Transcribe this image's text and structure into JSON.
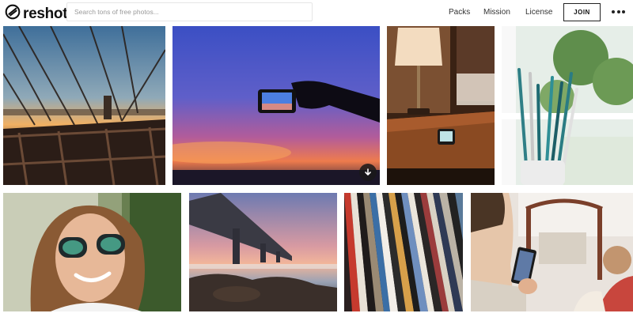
{
  "header": {
    "brand": "reshot",
    "search_placeholder": "Search tons of free photos...",
    "nav": {
      "packs": "Packs",
      "mission": "Mission",
      "license": "License"
    },
    "join_label": "JOIN"
  },
  "icons": {
    "logo": "reshot-logo-icon",
    "more": "more-dots-icon",
    "download": "download-arrow-icon"
  },
  "photos": [
    {
      "name": "photo-bridge-cables"
    },
    {
      "name": "photo-phone-sunset"
    },
    {
      "name": "photo-bedside-lamp"
    },
    {
      "name": "photo-paint-brushes"
    },
    {
      "name": "photo-woman-sunglasses"
    },
    {
      "name": "photo-pier-sunset"
    },
    {
      "name": "photo-vinyl-records"
    },
    {
      "name": "photo-man-phone"
    }
  ]
}
